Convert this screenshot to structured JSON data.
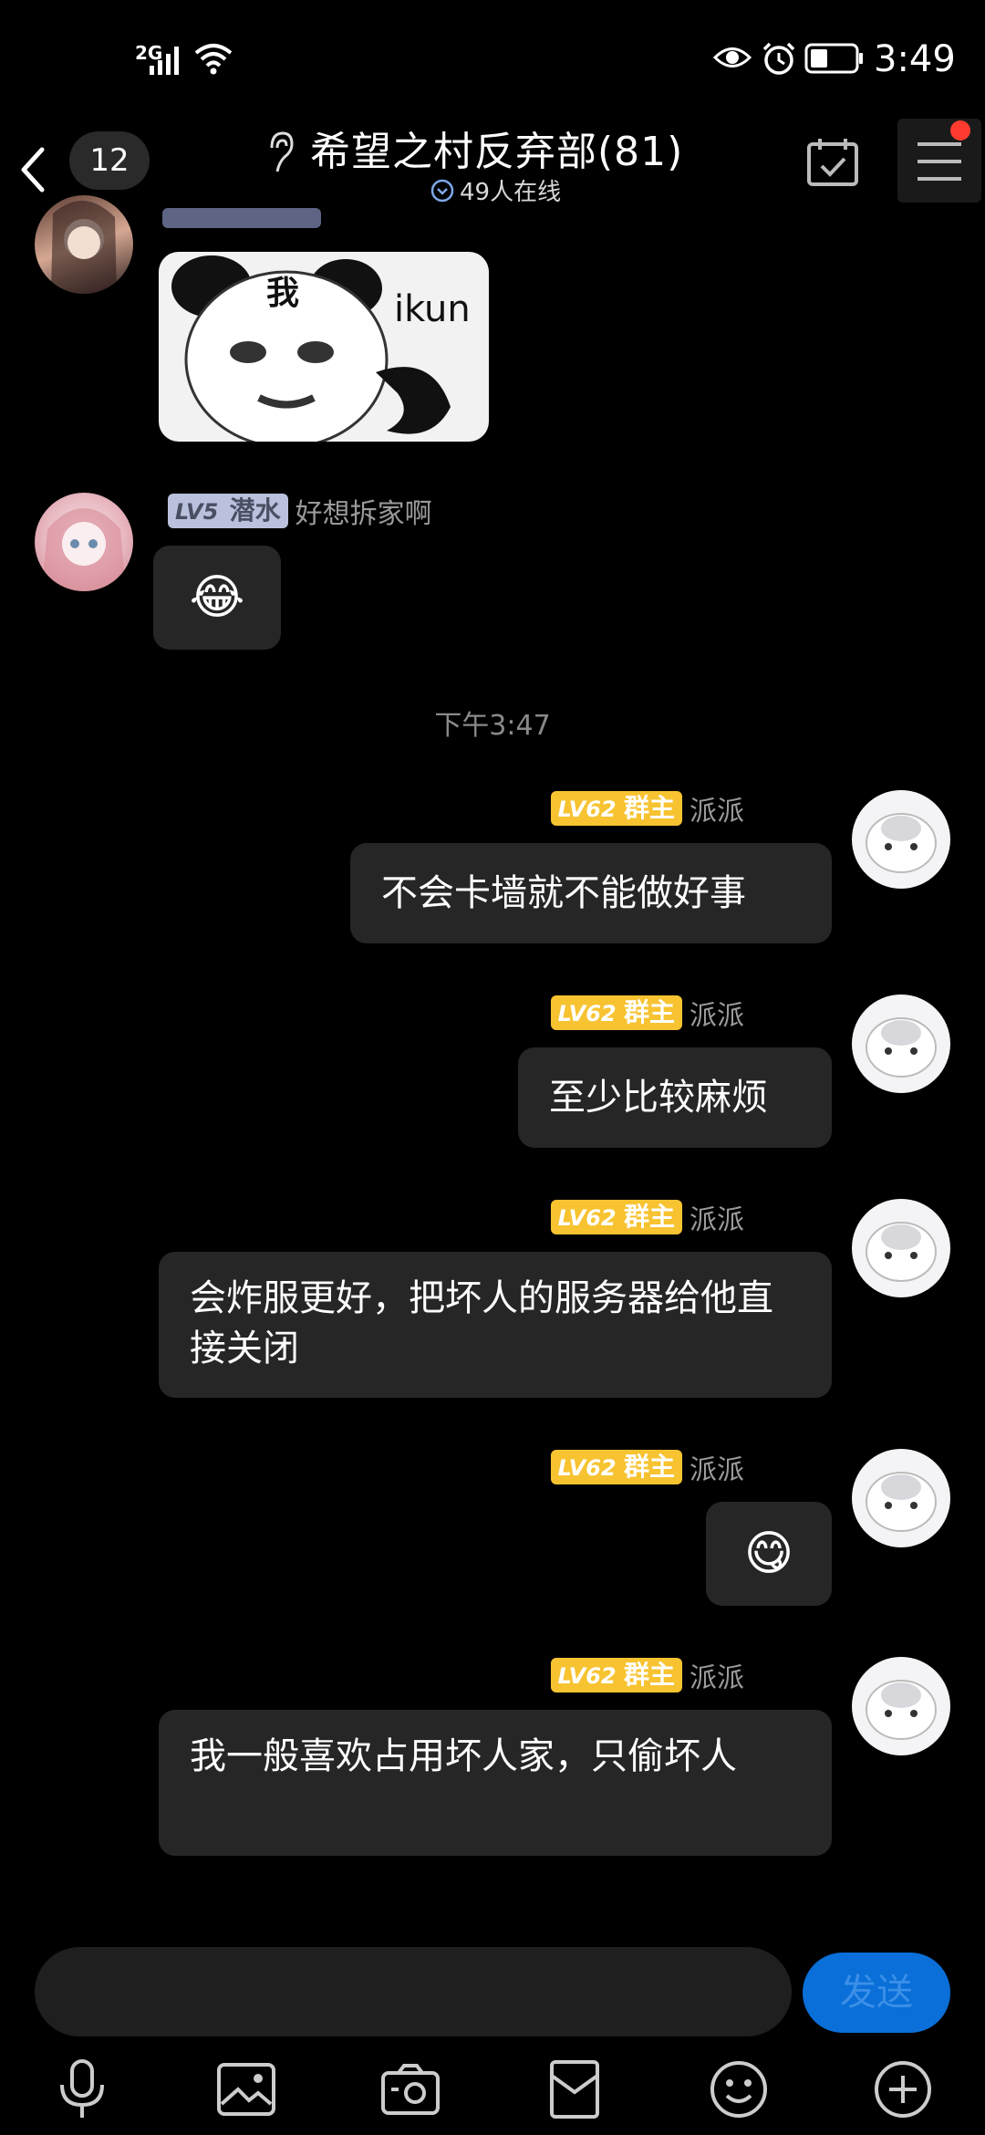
{
  "status_bar": {
    "network": "2G",
    "time": "3:49"
  },
  "header": {
    "unread_count": "12",
    "title": "希望之村反弃部(81)",
    "online_text": "49人在线"
  },
  "messages": [
    {
      "badge_level": "LV5",
      "badge_title": "潜水",
      "nickname": "好想拆家啊",
      "content_emoji": "😂"
    }
  ],
  "sticker": {
    "char": "我",
    "text": "ikun"
  },
  "time_separator": "下午3:47",
  "own_messages": [
    {
      "badge_level": "LV62",
      "badge_title": "群主",
      "nickname": "派派",
      "text": "不会卡墙就不能做好事"
    },
    {
      "badge_level": "LV62",
      "badge_title": "群主",
      "nickname": "派派",
      "text": "至少比较麻烦"
    },
    {
      "badge_level": "LV62",
      "badge_title": "群主",
      "nickname": "派派",
      "text": "会炸服更好，把坏人的服务器给他直接关闭"
    },
    {
      "badge_level": "LV62",
      "badge_title": "群主",
      "nickname": "派派",
      "emoji": "😋"
    },
    {
      "badge_level": "LV62",
      "badge_title": "群主",
      "nickname": "派派",
      "text": "我一般喜欢占用坏人家，只偷坏人"
    }
  ],
  "input": {
    "placeholder": "",
    "send_label": "发送"
  },
  "toolbar": [
    "microphone-icon",
    "image-icon",
    "camera-icon",
    "red-packet-icon",
    "emoji-icon",
    "plus-icon"
  ],
  "colors": {
    "owner_badge": "#f7c331",
    "member_badge": "#b9c1dd",
    "send_button": "#0a6fd8",
    "bubble": "#262626"
  }
}
